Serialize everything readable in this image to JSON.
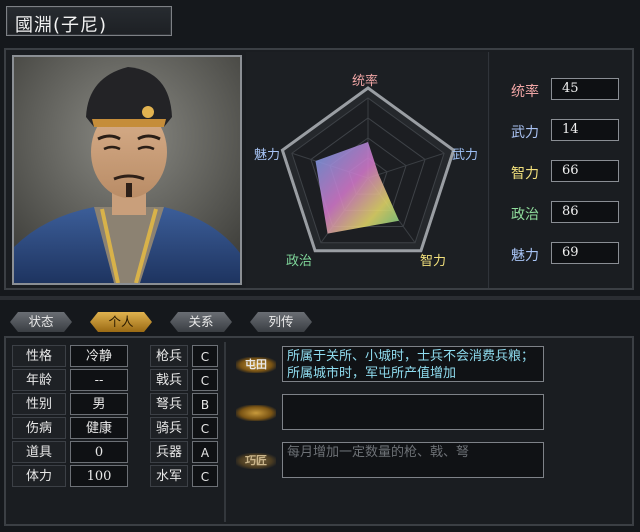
{
  "officer": {
    "name": "國淵(子尼)"
  },
  "radar": {
    "labels": {
      "leadership": "统率",
      "war": "武力",
      "intel": "智力",
      "politics": "政治",
      "charm": "魅力"
    },
    "label_colors": {
      "leadership": "#f0a5a5",
      "war": "#9ec0f5",
      "intel": "#f2e07c",
      "politics": "#7fd69a",
      "charm": "#a8c4f5"
    }
  },
  "stats": [
    {
      "name": "统率",
      "value": "45",
      "color": "#f0a5a5"
    },
    {
      "name": "武力",
      "value": "14",
      "color": "#a9c2f3"
    },
    {
      "name": "智力",
      "value": "66",
      "color": "#f2e07c"
    },
    {
      "name": "政治",
      "value": "86",
      "color": "#8fdc9c"
    },
    {
      "name": "魅力",
      "value": "69",
      "color": "#a8c4f5"
    }
  ],
  "tabs": [
    {
      "label": "状态",
      "active": false
    },
    {
      "label": "个人",
      "active": true
    },
    {
      "label": "关系",
      "active": false
    },
    {
      "label": "列传",
      "active": false
    }
  ],
  "personal": [
    {
      "key": "性格",
      "value": "冷静"
    },
    {
      "key": "年龄",
      "value": "--"
    },
    {
      "key": "性别",
      "value": "男"
    },
    {
      "key": "伤病",
      "value": "健康"
    },
    {
      "key": "道具",
      "value": "0"
    },
    {
      "key": "体力",
      "value": "100"
    }
  ],
  "aptitudes": [
    {
      "key": "枪兵",
      "value": "C"
    },
    {
      "key": "戟兵",
      "value": "C"
    },
    {
      "key": "弩兵",
      "value": "B"
    },
    {
      "key": "骑兵",
      "value": "C"
    },
    {
      "key": "兵器",
      "value": "A"
    },
    {
      "key": "水军",
      "value": "C"
    }
  ],
  "skills": [
    {
      "badge": "屯田",
      "description": "所属于关所、小城时，士兵不会消费兵粮；所属城市时，军屯所产值增加",
      "state": "active"
    },
    {
      "badge": "",
      "description": "",
      "state": "empty"
    },
    {
      "badge": "巧匠",
      "description": "每月增加一定数量的枪、戟、弩",
      "state": "faded"
    }
  ]
}
